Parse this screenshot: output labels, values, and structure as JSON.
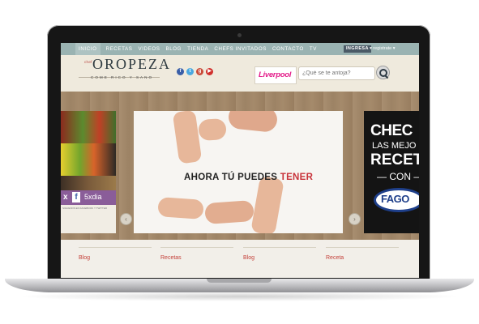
{
  "nav": {
    "items": [
      "INICIO",
      "RECETAS",
      "VIDEOS",
      "BLOG",
      "TIENDA",
      "CHEFS INVITADOS",
      "CONTACTO",
      "TV"
    ],
    "login_label": "INGRESA",
    "register_label": "registrate"
  },
  "header": {
    "logo_prefix": "chef",
    "logo_text": "OROPEZA",
    "tagline": "COME RICO Y SANO",
    "social": [
      "f",
      "t",
      "g",
      "▶"
    ],
    "banner_brand": "Liverpool",
    "search_placeholder": "¿Qué se te antoja?"
  },
  "carousel": {
    "left_social_x": "x",
    "left_social_fb": "f",
    "left_social_text": "5xdia",
    "left_fine_print": "SIGUENOS EN FACEBOOK Y TWITTER",
    "main_text_black": "AHORA TÚ PUEDES",
    "main_text_red": "TENER",
    "right_line1": "CHEC",
    "right_line2": "LAS MEJO",
    "right_line3": "RECETA",
    "right_line4": "— CON —",
    "right_brand": "FAGO",
    "prev_label": "‹",
    "next_label": "›"
  },
  "bottom": {
    "columns": [
      "Blog",
      "Recetas",
      "Blog",
      "Receta"
    ]
  },
  "colors": {
    "nav_bg": "#9ab3b2",
    "accent_red": "#c4413a",
    "header_bg": "#efeadd"
  }
}
